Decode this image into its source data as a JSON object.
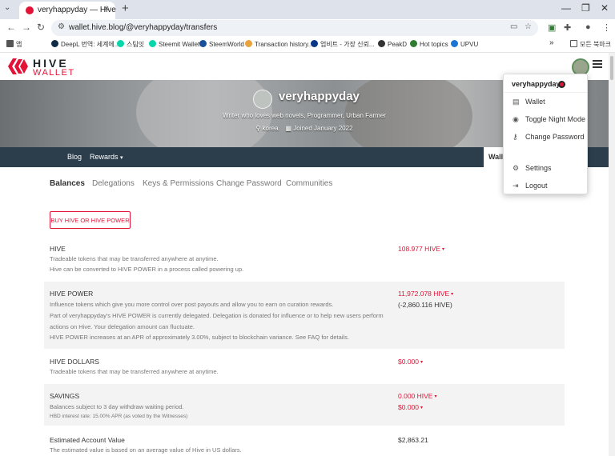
{
  "browser": {
    "tab_title": "veryhappyday — Hive",
    "tab_close": "×",
    "tab_list": "⌄",
    "new_tab": "+",
    "url": "wallet.hive.blog/@veryhappyday/transfers",
    "bookmarks": [
      {
        "label": "앱",
        "color": "#4a6cd4"
      },
      {
        "label": "DeepL 번역: 세계에...",
        "color": "#0f2b46"
      },
      {
        "label": "스팀잇",
        "color": "#06d6a9"
      },
      {
        "label": "Steemit Wallet",
        "color": "#06d6a9"
      },
      {
        "label": "SteemWorld",
        "color": "#1a5099"
      },
      {
        "label": "Transaction history...",
        "color": "#e8a33c"
      },
      {
        "label": "업비트 - 가장 신뢰...",
        "color": "#093687"
      },
      {
        "label": "PeakD",
        "color": "#333333"
      },
      {
        "label": "Hot topics",
        "color": "#2e7d32"
      },
      {
        "label": "UPVU",
        "color": "#1976d2"
      }
    ],
    "bookmarks_more": "»",
    "bookmarks_folder": "모든 북마크"
  },
  "header": {
    "logo_hive": "HIVE",
    "logo_wallet": "WALLET"
  },
  "profile": {
    "name": "veryhappyday",
    "about": "Writer who loves web novels, Programmer, Urban Farmer",
    "location": "korea",
    "joined": "Joined January 2022"
  },
  "nav": {
    "blog": "Blog",
    "rewards": "Rewards",
    "rewards_caret": "▾",
    "wallet": "Walle"
  },
  "subtabs": [
    "Balances",
    "Delegations",
    "Keys & Permissions",
    "Change Password",
    "Communities"
  ],
  "buy_button": "BUY HIVE OR HIVE POWER",
  "balances": {
    "hive": {
      "title": "HIVE",
      "desc1": "Tradeable tokens that may be transferred anywhere at anytime.",
      "desc2": "Hive can be converted to HIVE POWER in a process called powering up.",
      "value": "108.977 HIVE"
    },
    "hive_power": {
      "title": "HIVE POWER",
      "desc1": "Influence tokens which give you more control over post payouts and allow you to earn on curation rewards.",
      "desc2": "Part of veryhappyday's HIVE POWER is currently delegated. Delegation is donated for influence or to help new users perform",
      "desc3": "actions on Hive. Your delegation amount can fluctuate.",
      "desc4": "HIVE POWER increases at an APR of approximately 3.00%, subject to blockchain variance. See FAQ for details.",
      "value": "11,972.078 HIVE",
      "delegated": "(-2,860.116 HIVE)"
    },
    "hive_dollars": {
      "title": "HIVE DOLLARS",
      "desc1": "Tradeable tokens that may be transferred anywhere at anytime.",
      "value": "$0.000"
    },
    "savings": {
      "title": "SAVINGS",
      "desc1": "Balances subject to 3 day withdraw waiting period.",
      "desc2": "HBD interest rate: 15.00% APR (as voted by the Witnesses)",
      "value_hive": "0.000 HIVE",
      "value_hbd": "$0.000"
    },
    "estimated": {
      "title": "Estimated Account Value",
      "desc1": "The estimated value is based on an average value of Hive in US dollars.",
      "value": "$2,863.21"
    }
  },
  "caret": "▾",
  "dropdown": {
    "username": "veryhappyday",
    "items": [
      {
        "label": "Wallet",
        "icon": "wallet-icon"
      },
      {
        "label": "Toggle Night Mode",
        "icon": "eye-icon"
      },
      {
        "label": "Change Password",
        "icon": "key-icon"
      },
      {
        "label": "Settings",
        "icon": "gear-icon"
      },
      {
        "label": "Logout",
        "icon": "logout-icon"
      }
    ]
  },
  "colors": {
    "brand": "#e31337",
    "nav_bg": "#2c3e4c"
  }
}
